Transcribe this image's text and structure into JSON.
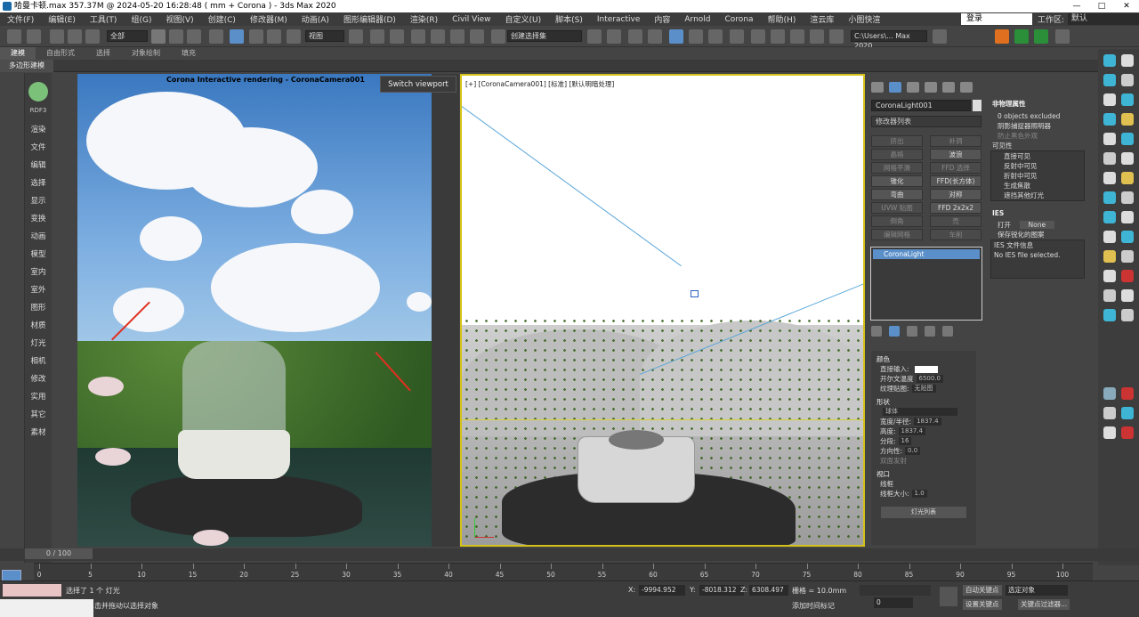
{
  "title": "哈曼卡顿.max   357.37M @ 2024-05-20 16:28:48  ( mm + Corona ) - 3ds Max 2020",
  "window_buttons": [
    "—",
    "□",
    "✕"
  ],
  "menu": [
    "文件(F)",
    "编辑(E)",
    "工具(T)",
    "组(G)",
    "视图(V)",
    "创建(C)",
    "修改器(M)",
    "动画(A)",
    "图形编辑器(D)",
    "渲染(R)",
    "Civil View",
    "自定义(U)",
    "脚本(S)",
    "Interactive",
    "内容",
    "Arnold",
    "Corona",
    "帮助(H)",
    "渲云库",
    "小图快渲"
  ],
  "login": "登录",
  "workspace_label": "工作区:",
  "workspace_value": "默认",
  "toolbar": {
    "filter": "全部",
    "view": "视图",
    "create_selection_set": "创建选择集",
    "path": "C:\\Users\\... Max 2020"
  },
  "ribbon_tabs": [
    "建模",
    "自由形式",
    "选择",
    "对象绘制",
    "填充"
  ],
  "subribbon": "多边形建模",
  "category": {
    "name": "RDF3",
    "items": [
      "渲染",
      "文件",
      "编辑",
      "选择",
      "显示",
      "变换",
      "动画",
      "模型",
      "室内",
      "室外",
      "图形",
      "材质",
      "灯光",
      "相机",
      "修改",
      "实用",
      "其它",
      "素材"
    ]
  },
  "viewport1": {
    "title": "Corona Interactive rendering - CoronaCamera001",
    "switch_button": "Switch viewport"
  },
  "viewport2": {
    "label": "[+] [CoronaCamera001] [标准] [默认明暗处理]"
  },
  "command_panel": {
    "object_name": "CoronaLight001",
    "modifier_list": "修改器列表",
    "modifier_buttons": [
      {
        "label": "挤出",
        "dim": true
      },
      {
        "label": "补洞",
        "dim": true
      },
      {
        "label": "晶格",
        "dim": true
      },
      {
        "label": "波浪",
        "dim": false
      },
      {
        "label": "网格平滑",
        "dim": true
      },
      {
        "label": "FFD 选择",
        "dim": true
      },
      {
        "label": "锥化",
        "dim": false
      },
      {
        "label": "FFD(长方体)",
        "dim": false
      },
      {
        "label": "弯曲",
        "dim": false
      },
      {
        "label": "对称",
        "dim": false
      },
      {
        "label": "UVW 贴图",
        "dim": true
      },
      {
        "label": "FFD 2x2x2",
        "dim": false
      },
      {
        "label": "倒角",
        "dim": true
      },
      {
        "label": "壳",
        "dim": true
      },
      {
        "label": "编辑网格",
        "dim": true
      },
      {
        "label": "车削",
        "dim": true
      }
    ],
    "stack_item": "CoronaLight",
    "color_header": "颜色",
    "direct_input": "直接输入:",
    "kelvin": "开尔文温度",
    "kelvin_value": "6500.0",
    "texmap": "纹理贴图:",
    "texmap_value": "无贴图",
    "shape_header": "形状",
    "shape_value": "球体",
    "width_radius": "宽度/半径:",
    "width_value": "1837.4",
    "height": "高度:",
    "height_value": "1837.4",
    "segments": "分段:",
    "segments_value": "16",
    "direction": "方向性:",
    "direction_value": "0.0",
    "double_sided": "双面发射",
    "viewport_header": "视口",
    "wireframe": "线框",
    "wire_size": "线框大小:",
    "wire_size_value": "1.0",
    "light_list": "灯光列表"
  },
  "right_props": {
    "nonphysical": "非物理属性",
    "excluded": "0 objects excluded",
    "shadow_catcher": "阴影捕捉器照明器",
    "prevent_black": "防止黑色外观",
    "visibility": "可见性",
    "vis_items": [
      "直接可见",
      "反射中可见",
      "折射中可见",
      "生成焦散",
      "遮挡其他灯光"
    ],
    "ies": "IES",
    "ies_on": "打开",
    "ies_none": "None",
    "keep_sharp": "保存锐化的图案",
    "ies_info": "IES 文件信息",
    "no_ies": "No IES file selected."
  },
  "timeline": {
    "frame": "0 / 100",
    "ticks": [
      "0",
      "5",
      "10",
      "15",
      "20",
      "25",
      "30",
      "35",
      "40",
      "45",
      "50",
      "55",
      "60",
      "65",
      "70",
      "75",
      "80",
      "85",
      "90",
      "95",
      "100"
    ]
  },
  "status": {
    "selected": "选择了 1 个 灯光",
    "hint": "单击或单击并拖动以选择对象",
    "x": "-9994.952",
    "y": "-8018.312",
    "z": "6308.497",
    "grid": "栅格 = 10.0mm",
    "add_time_tag": "添加时间标记",
    "auto_key": "自动关键点",
    "selected_obj": "选定对象",
    "set_key": "设置关键点",
    "key_filter": "关键点过滤器...",
    "frame_field": "0"
  },
  "accent": "#5a8fc9"
}
